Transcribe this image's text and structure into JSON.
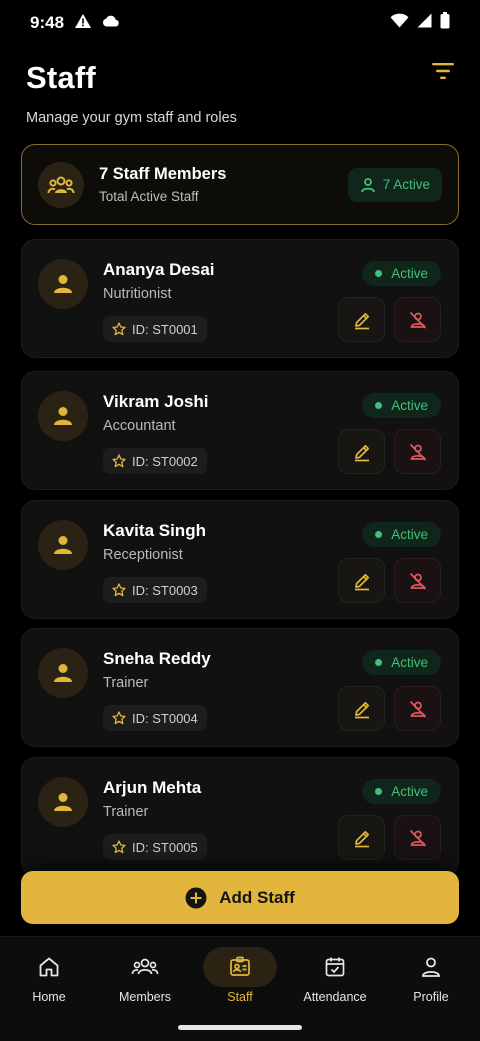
{
  "status_bar": {
    "time": "9:48"
  },
  "header": {
    "title": "Staff",
    "subtitle": "Manage your gym staff and roles"
  },
  "summary": {
    "title": "7 Staff Members",
    "subtitle": "Total Active Staff",
    "active_label": "7 Active"
  },
  "staff": [
    {
      "name": "Ananya Desai",
      "role": "Nutritionist",
      "id": "ID: ST0001",
      "status": "Active"
    },
    {
      "name": "Vikram Joshi",
      "role": "Accountant",
      "id": "ID: ST0002",
      "status": "Active"
    },
    {
      "name": "Kavita Singh",
      "role": "Receptionist",
      "id": "ID: ST0003",
      "status": "Active"
    },
    {
      "name": "Sneha Reddy",
      "role": "Trainer",
      "id": "ID: ST0004",
      "status": "Active"
    },
    {
      "name": "Arjun Mehta",
      "role": "Trainer",
      "id": "ID: ST0005",
      "status": "Active"
    }
  ],
  "add_button": {
    "label": "Add Staff"
  },
  "nav": [
    {
      "label": "Home",
      "icon": "home-icon"
    },
    {
      "label": "Members",
      "icon": "members-icon"
    },
    {
      "label": "Staff",
      "icon": "staff-icon",
      "active": true
    },
    {
      "label": "Attendance",
      "icon": "attendance-icon"
    },
    {
      "label": "Profile",
      "icon": "profile-icon"
    }
  ],
  "colors": {
    "accent": "#e2b63d",
    "active_green": "#42c07a",
    "danger": "#e0575b",
    "background": "#000000"
  }
}
